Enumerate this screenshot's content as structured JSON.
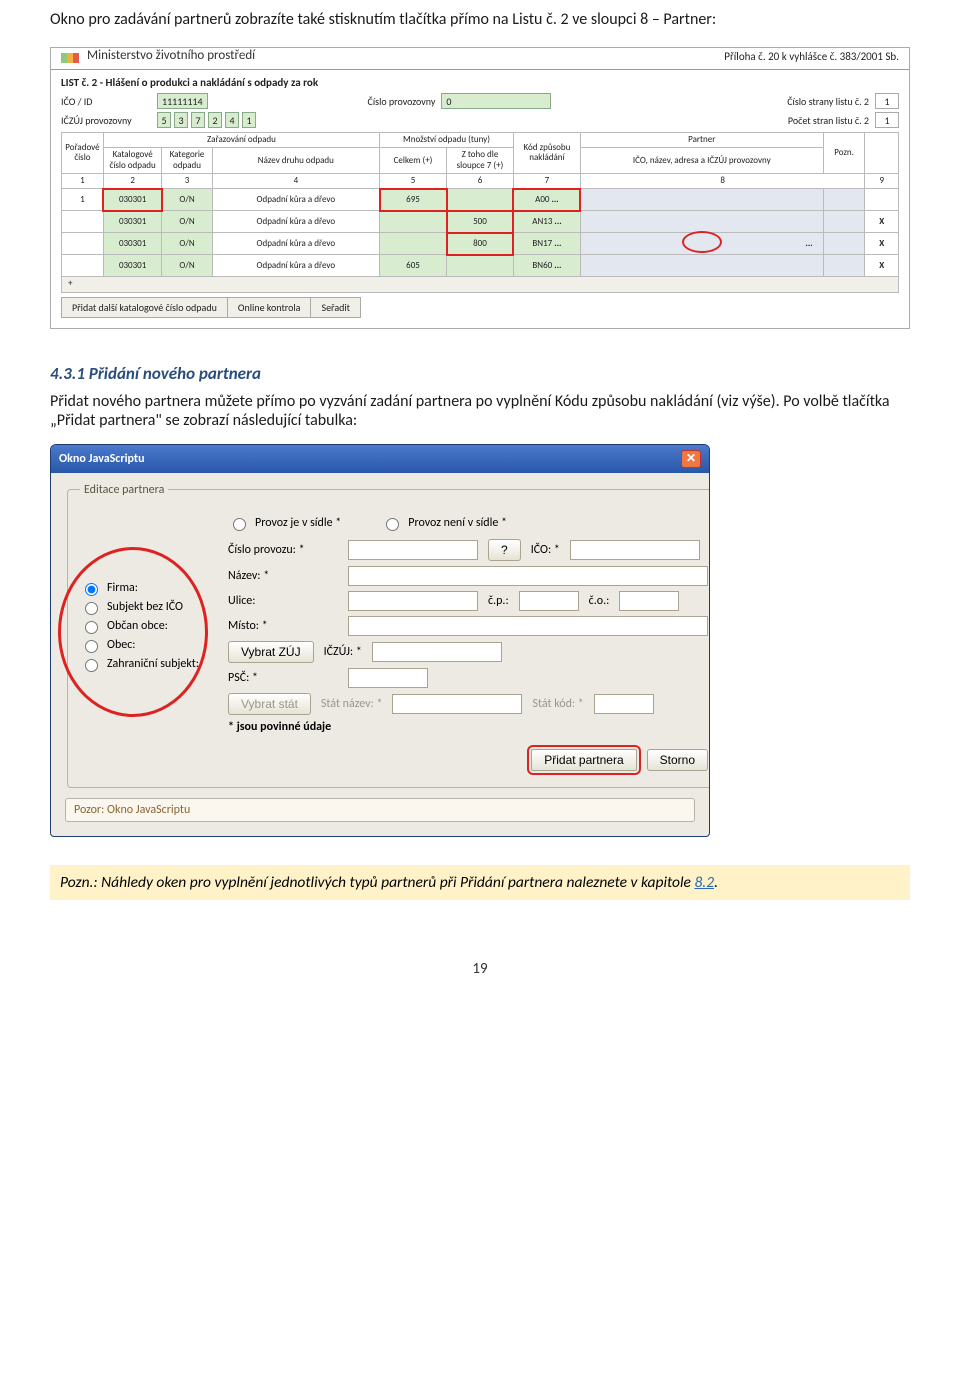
{
  "intro": "Okno pro zadávání partnerů zobrazíte také stisknutím tlačítka přímo na Listu č. 2 ve sloupci 8 – Partner:",
  "shot1": {
    "brand": "Ministerstvo životního prostředí",
    "topright": "Příloha č. 20 k vyhlášce č. 383/2001 Sb.",
    "listTitle": "LIST č. 2 - Hlášení o produkci a nakládání s odpady za rok",
    "ico_lbl": "IČO / ID",
    "ico_val": "11111114",
    "provoz_lbl": "Číslo provozovny",
    "provoz_val": "0",
    "strana_lbl": "Číslo strany listu č. 2",
    "strana_val": "1",
    "iczuj_lbl": "IČZÚJ provozovny",
    "iczuj_digits": [
      "5",
      "3",
      "7",
      "2",
      "4",
      "1"
    ],
    "pocet_lbl": "Počet stran listu č. 2",
    "pocet_val": "1",
    "heads": {
      "porad": "Pořadové číslo",
      "zaraz": "Zařazování odpadu",
      "katalog": "Katalogové číslo odpadu",
      "kateg": "Kategorie odpadu",
      "nazev": "Název druhu odpadu",
      "mnoz": "Množství odpadu (tuny)",
      "celk": "Celkem (+)",
      "ztoh": "Z toho dle sloupce 7 (+)",
      "kod": "Kód způsobu nakládání",
      "partner": "Partner",
      "partner_sub": "IČO, název, adresa a IČZÚJ provozovny",
      "pozn": "Pozn."
    },
    "colnums": [
      "1",
      "2",
      "3",
      "4",
      "5",
      "6",
      "7",
      "8",
      "9"
    ],
    "rows": [
      {
        "n": "1",
        "kat": "030301",
        "kateg": "O/N",
        "naz": "Odpadní kůra a dřevo",
        "c": "695",
        "z": "",
        "kod": "A00",
        "part": "",
        "x": ""
      },
      {
        "n": "",
        "kat": "030301",
        "kateg": "O/N",
        "naz": "Odpadní kůra a dřevo",
        "c": "",
        "z": "500",
        "kod": "AN13",
        "part": "",
        "x": "X"
      },
      {
        "n": "",
        "kat": "030301",
        "kateg": "O/N",
        "naz": "Odpadní kůra a dřevo",
        "c": "",
        "z": "800",
        "kod": "BN17",
        "part": "...",
        "x": "X",
        "partdots": true
      },
      {
        "n": "",
        "kat": "030301",
        "kateg": "O/N",
        "naz": "Odpadní kůra a dřevo",
        "c": "605",
        "z": "",
        "kod": "BN60",
        "part": "",
        "x": "X"
      }
    ],
    "plus": "+",
    "toolbar": [
      "Přidat další katalogové číslo odpadu",
      "Online kontrola",
      "Seřadit"
    ]
  },
  "sec_h": "4.3.1    Přidání nového partnera",
  "sec_p": "Přidat nového partnera můžete přímo po vyzvání zadání partnera po vyplnění Kódu způsobu nakládání (viz výše). Po volbě tlačítka „Přidat partnera\" se zobrazí následující tabulka:",
  "dlg": {
    "title": "Okno JavaScriptu",
    "legend": "Editace partnera",
    "radios_top": {
      "r1": "Provoz je v sídle *",
      "r2": "Provoz není v sídle *"
    },
    "left_radios": [
      "Firma:",
      "Subjekt bez IČO",
      "Občan obce:",
      "Obec:",
      "Zahraniční subjekt:"
    ],
    "lbl_cislo": "Číslo provozu: *",
    "btn_q": "?",
    "lbl_ico": "IČO: *",
    "lbl_nazev": "Název: *",
    "lbl_ulice": "Ulice:",
    "lbl_cp": "č.p.:",
    "lbl_co": "č.o.:",
    "lbl_misto": "Místo: *",
    "btn_zuj": "Vybrat ZÚJ",
    "lbl_iczuj": "IČZÚJ: *",
    "lbl_psc": "PSČ: *",
    "btn_stat": "Vybrat stát",
    "lbl_statn": "Stát název: *",
    "lbl_statk": "Stát kód: *",
    "mandatory": "* jsou povinné údaje",
    "btn_add": "Přidat partnera",
    "btn_cancel": "Storno",
    "warn": "Pozor: Okno JavaScriptu"
  },
  "note_pre": "Pozn.: Náhledy oken pro vyplnění jednotlivých typů partnerů při Přidání partnera naleznete v kapitole ",
  "note_link": "8.2",
  "note_post": ".",
  "pagenum": "19"
}
